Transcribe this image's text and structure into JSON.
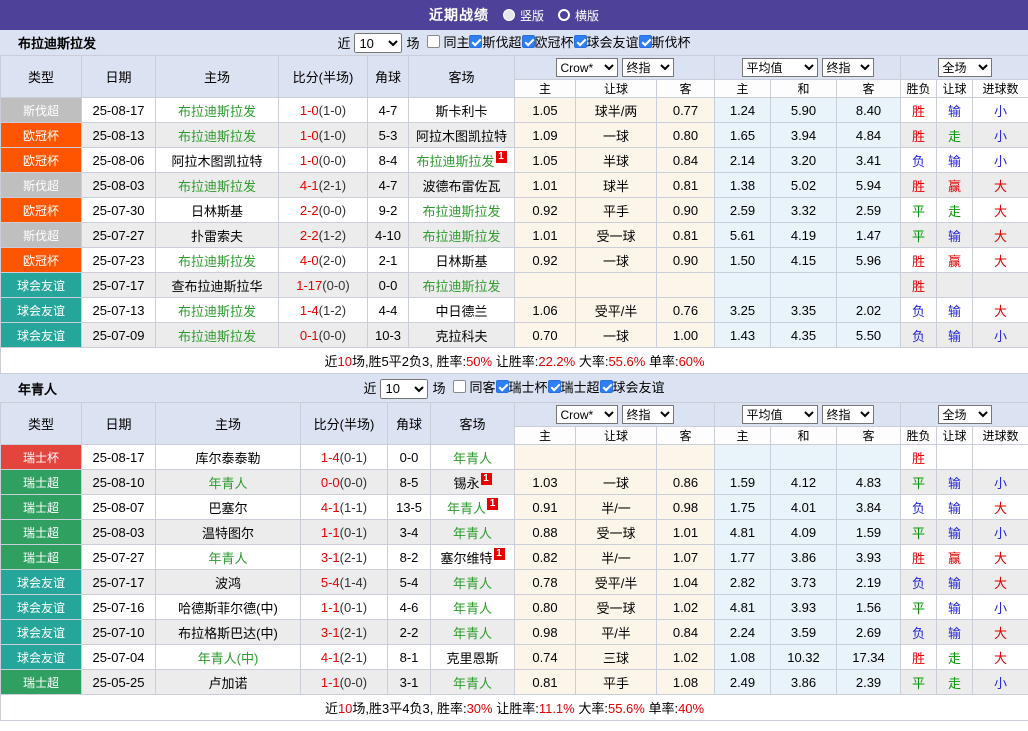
{
  "titlebar": {
    "title": "近期战绩",
    "options": [
      {
        "label": "竖版",
        "selected": true
      },
      {
        "label": "横版",
        "selected": false
      }
    ]
  },
  "table_header": {
    "cols": [
      "类型",
      "日期",
      "主场",
      "比分(半场)",
      "角球",
      "客场"
    ],
    "sub": [
      "主",
      "让球",
      "客",
      "主",
      "和",
      "客",
      "胜负",
      "让球",
      "进球数"
    ],
    "selects": {
      "odds_source": "Crow*",
      "odds_final": "终指",
      "europe_avg": "平均值",
      "europe_final": "终指",
      "scope": "全场"
    }
  },
  "type_colors": {
    "斯伐超": "#bfbfbf",
    "欧冠杯": "#ff5500",
    "球会友谊": "#26a69a",
    "瑞士杯": "#e3453d",
    "瑞士超": "#2fa05f"
  },
  "result_colors": {
    "胜": "red",
    "负": "blue",
    "平": "green",
    "赢": "red",
    "输": "blue",
    "走": "green",
    "大": "red",
    "小": "blue"
  },
  "sections": [
    {
      "team": "布拉迪斯拉发",
      "filter": {
        "near": "近",
        "count": "10",
        "unit": "场",
        "same": {
          "label": "同主",
          "checked": false
        },
        "leagues": [
          {
            "label": "斯伐超",
            "checked": true
          },
          {
            "label": "欧冠杯",
            "checked": true
          },
          {
            "label": "球会友谊",
            "checked": true
          },
          {
            "label": "斯伐杯",
            "checked": true
          }
        ]
      },
      "rows": [
        {
          "type": "斯伐超",
          "date": "25-08-17",
          "home": "布拉迪斯拉发",
          "home_green": true,
          "home_card": "",
          "score": "1-0",
          "half": "(1-0)",
          "corner": "4-7",
          "away": "斯卡利卡",
          "away_green": false,
          "away_card": "",
          "odds": [
            "1.05",
            "球半/两",
            "0.77"
          ],
          "avg": [
            "1.24",
            "5.90",
            "8.40"
          ],
          "res": [
            "胜",
            "输",
            "小"
          ]
        },
        {
          "type": "欧冠杯",
          "date": "25-08-13",
          "home": "布拉迪斯拉发",
          "home_green": true,
          "home_card": "",
          "score": "1-0",
          "half": "(1-0)",
          "corner": "5-3",
          "away": "阿拉木图凯拉特",
          "away_green": false,
          "away_card": "",
          "odds": [
            "1.09",
            "一球",
            "0.80"
          ],
          "avg": [
            "1.65",
            "3.94",
            "4.84"
          ],
          "res": [
            "胜",
            "走",
            "小"
          ]
        },
        {
          "type": "欧冠杯",
          "date": "25-08-06",
          "home": "阿拉木图凯拉特",
          "home_green": false,
          "home_card": "",
          "score": "1-0",
          "half": "(0-0)",
          "corner": "8-4",
          "away": "布拉迪斯拉发",
          "away_green": true,
          "away_card": "1",
          "odds": [
            "1.05",
            "半球",
            "0.84"
          ],
          "avg": [
            "2.14",
            "3.20",
            "3.41"
          ],
          "res": [
            "负",
            "输",
            "小"
          ]
        },
        {
          "type": "斯伐超",
          "date": "25-08-03",
          "home": "布拉迪斯拉发",
          "home_green": true,
          "home_card": "",
          "score": "4-1",
          "half": "(2-1)",
          "corner": "4-7",
          "away": "波德布雷佐瓦",
          "away_green": false,
          "away_card": "",
          "odds": [
            "1.01",
            "球半",
            "0.81"
          ],
          "avg": [
            "1.38",
            "5.02",
            "5.94"
          ],
          "res": [
            "胜",
            "赢",
            "大"
          ]
        },
        {
          "type": "欧冠杯",
          "date": "25-07-30",
          "home": "日林斯基",
          "home_green": false,
          "home_card": "",
          "score": "2-2",
          "half": "(0-0)",
          "corner": "9-2",
          "away": "布拉迪斯拉发",
          "away_green": true,
          "away_card": "",
          "odds": [
            "0.92",
            "平手",
            "0.90"
          ],
          "avg": [
            "2.59",
            "3.32",
            "2.59"
          ],
          "res": [
            "平",
            "走",
            "大"
          ]
        },
        {
          "type": "斯伐超",
          "date": "25-07-27",
          "home": "扑雷索夫",
          "home_green": false,
          "home_card": "",
          "score": "2-2",
          "half": "(1-2)",
          "corner": "4-10",
          "away": "布拉迪斯拉发",
          "away_green": true,
          "away_card": "",
          "odds": [
            "1.01",
            "受一球",
            "0.81"
          ],
          "avg": [
            "5.61",
            "4.19",
            "1.47"
          ],
          "res": [
            "平",
            "输",
            "大"
          ]
        },
        {
          "type": "欧冠杯",
          "date": "25-07-23",
          "home": "布拉迪斯拉发",
          "home_green": true,
          "home_card": "",
          "score": "4-0",
          "half": "(2-0)",
          "corner": "2-1",
          "away": "日林斯基",
          "away_green": false,
          "away_card": "",
          "odds": [
            "0.92",
            "一球",
            "0.90"
          ],
          "avg": [
            "1.50",
            "4.15",
            "5.96"
          ],
          "res": [
            "胜",
            "赢",
            "大"
          ]
        },
        {
          "type": "球会友谊",
          "date": "25-07-17",
          "home": "查布拉迪斯拉华",
          "home_green": false,
          "home_card": "",
          "score": "1-17",
          "half": "(0-0)",
          "corner": "0-0",
          "away": "布拉迪斯拉发",
          "away_green": true,
          "away_card": "",
          "odds": [
            "",
            "",
            ""
          ],
          "avg": [
            "",
            "",
            ""
          ],
          "res": [
            "胜",
            "",
            ""
          ]
        },
        {
          "type": "球会友谊",
          "date": "25-07-13",
          "home": "布拉迪斯拉发",
          "home_green": true,
          "home_card": "",
          "score": "1-4",
          "half": "(1-2)",
          "corner": "4-4",
          "away": "中日德兰",
          "away_green": false,
          "away_card": "",
          "odds": [
            "1.06",
            "受平/半",
            "0.76"
          ],
          "avg": [
            "3.25",
            "3.35",
            "2.02"
          ],
          "res": [
            "负",
            "输",
            "大"
          ]
        },
        {
          "type": "球会友谊",
          "date": "25-07-09",
          "home": "布拉迪斯拉发",
          "home_green": true,
          "home_card": "",
          "score": "0-1",
          "half": "(0-0)",
          "corner": "10-3",
          "away": "克拉科夫",
          "away_green": false,
          "away_card": "",
          "odds": [
            "0.70",
            "一球",
            "1.00"
          ],
          "avg": [
            "1.43",
            "4.35",
            "5.50"
          ],
          "res": [
            "负",
            "输",
            "小"
          ]
        }
      ],
      "summary": [
        {
          "t": "近",
          "red": false
        },
        {
          "t": "10",
          "red": true
        },
        {
          "t": "场,胜5平2负3, 胜率:",
          "red": false
        },
        {
          "t": "50%",
          "red": true
        },
        {
          "t": " 让胜率:",
          "red": false
        },
        {
          "t": "22.2%",
          "red": true
        },
        {
          "t": " 大率:",
          "red": false
        },
        {
          "t": "55.6%",
          "red": true
        },
        {
          "t": " 单率:",
          "red": false
        },
        {
          "t": "60%",
          "red": true
        }
      ]
    },
    {
      "team": "年青人",
      "filter": {
        "near": "近",
        "count": "10",
        "unit": "场",
        "same": {
          "label": "同客",
          "checked": false
        },
        "leagues": [
          {
            "label": "瑞士杯",
            "checked": true
          },
          {
            "label": "瑞士超",
            "checked": true
          },
          {
            "label": "球会友谊",
            "checked": true
          }
        ]
      },
      "rows": [
        {
          "type": "瑞士杯",
          "date": "25-08-17",
          "home": "库尔泰泰勒",
          "home_green": false,
          "home_card": "",
          "score": "1-4",
          "half": "(0-1)",
          "corner": "0-0",
          "away": "年青人",
          "away_green": true,
          "away_card": "",
          "odds": [
            "",
            "",
            ""
          ],
          "avg": [
            "",
            "",
            ""
          ],
          "res": [
            "胜",
            "",
            ""
          ]
        },
        {
          "type": "瑞士超",
          "date": "25-08-10",
          "home": "年青人",
          "home_green": true,
          "home_card": "",
          "score": "0-0",
          "half": "(0-0)",
          "corner": "8-5",
          "away": "锡永",
          "away_green": false,
          "away_card": "1",
          "odds": [
            "1.03",
            "一球",
            "0.86"
          ],
          "avg": [
            "1.59",
            "4.12",
            "4.83"
          ],
          "res": [
            "平",
            "输",
            "小"
          ]
        },
        {
          "type": "瑞士超",
          "date": "25-08-07",
          "home": "巴塞尔",
          "home_green": false,
          "home_card": "",
          "score": "4-1",
          "half": "(1-1)",
          "corner": "13-5",
          "away": "年青人",
          "away_green": true,
          "away_card": "1",
          "odds": [
            "0.91",
            "半/一",
            "0.98"
          ],
          "avg": [
            "1.75",
            "4.01",
            "3.84"
          ],
          "res": [
            "负",
            "输",
            "大"
          ]
        },
        {
          "type": "瑞士超",
          "date": "25-08-03",
          "home": "温特图尔",
          "home_green": false,
          "home_card": "",
          "score": "1-1",
          "half": "(0-1)",
          "corner": "3-4",
          "away": "年青人",
          "away_green": true,
          "away_card": "",
          "odds": [
            "0.88",
            "受一球",
            "1.01"
          ],
          "avg": [
            "4.81",
            "4.09",
            "1.59"
          ],
          "res": [
            "平",
            "输",
            "小"
          ]
        },
        {
          "type": "瑞士超",
          "date": "25-07-27",
          "home": "年青人",
          "home_green": true,
          "home_card": "",
          "score": "3-1",
          "half": "(2-1)",
          "corner": "8-2",
          "away": "塞尔维特",
          "away_green": false,
          "away_card": "1",
          "odds": [
            "0.82",
            "半/一",
            "1.07"
          ],
          "avg": [
            "1.77",
            "3.86",
            "3.93"
          ],
          "res": [
            "胜",
            "赢",
            "大"
          ]
        },
        {
          "type": "球会友谊",
          "date": "25-07-17",
          "home": "波鸿",
          "home_green": false,
          "home_card": "",
          "score": "5-4",
          "half": "(1-4)",
          "corner": "5-4",
          "away": "年青人",
          "away_green": true,
          "away_card": "",
          "odds": [
            "0.78",
            "受平/半",
            "1.04"
          ],
          "avg": [
            "2.82",
            "3.73",
            "2.19"
          ],
          "res": [
            "负",
            "输",
            "大"
          ]
        },
        {
          "type": "球会友谊",
          "date": "25-07-16",
          "home": "哈德斯菲尔德(中)",
          "home_green": false,
          "home_card": "",
          "score": "1-1",
          "half": "(0-1)",
          "corner": "4-6",
          "away": "年青人",
          "away_green": true,
          "away_card": "",
          "odds": [
            "0.80",
            "受一球",
            "1.02"
          ],
          "avg": [
            "4.81",
            "3.93",
            "1.56"
          ],
          "res": [
            "平",
            "输",
            "小"
          ]
        },
        {
          "type": "球会友谊",
          "date": "25-07-10",
          "home": "布拉格斯巴达(中)",
          "home_green": false,
          "home_card": "",
          "score": "3-1",
          "half": "(2-1)",
          "corner": "2-2",
          "away": "年青人",
          "away_green": true,
          "away_card": "",
          "odds": [
            "0.98",
            "平/半",
            "0.84"
          ],
          "avg": [
            "2.24",
            "3.59",
            "2.69"
          ],
          "res": [
            "负",
            "输",
            "大"
          ]
        },
        {
          "type": "球会友谊",
          "date": "25-07-04",
          "home": "年青人(中)",
          "home_green": true,
          "home_card": "",
          "score": "4-1",
          "half": "(2-1)",
          "corner": "8-1",
          "away": "克里恩斯",
          "away_green": false,
          "away_card": "",
          "odds": [
            "0.74",
            "三球",
            "1.02"
          ],
          "avg": [
            "1.08",
            "10.32",
            "17.34"
          ],
          "res": [
            "胜",
            "走",
            "大"
          ]
        },
        {
          "type": "瑞士超",
          "date": "25-05-25",
          "home": "卢加诺",
          "home_green": false,
          "home_card": "",
          "score": "1-1",
          "half": "(0-0)",
          "corner": "3-1",
          "away": "年青人",
          "away_green": true,
          "away_card": "",
          "odds": [
            "0.81",
            "平手",
            "1.08"
          ],
          "avg": [
            "2.49",
            "3.86",
            "2.39"
          ],
          "res": [
            "平",
            "走",
            "小"
          ]
        }
      ],
      "summary": [
        {
          "t": "近",
          "red": false
        },
        {
          "t": "10",
          "red": true
        },
        {
          "t": "场,胜3平4负3, 胜率:",
          "red": false
        },
        {
          "t": "30%",
          "red": true
        },
        {
          "t": " 让胜率:",
          "red": false
        },
        {
          "t": "11.1%",
          "red": true
        },
        {
          "t": " 大率:",
          "red": false
        },
        {
          "t": "55.6%",
          "red": true
        },
        {
          "t": " 单率:",
          "red": false
        },
        {
          "t": "40%",
          "red": true
        }
      ]
    }
  ]
}
